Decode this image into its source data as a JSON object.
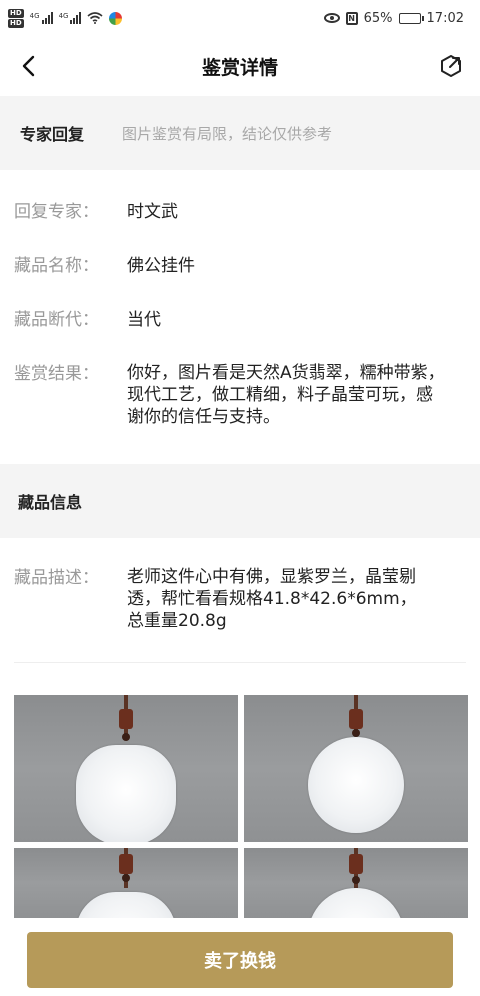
{
  "status_bar": {
    "hd_top": "HD",
    "hd_bottom": "HD",
    "signal_label_1": "4G",
    "signal_label_2": "4G",
    "battery_percent": "65%",
    "time": "17:02",
    "battery_level": 0.65,
    "icons": [
      "hd-icon",
      "signal-icon",
      "wifi-icon",
      "app-icon",
      "eye-icon",
      "nfc-icon",
      "battery-icon"
    ]
  },
  "header": {
    "title": "鉴赏详情",
    "back_icon": "chevron-left-icon",
    "share_icon": "share-icon"
  },
  "expert_section": {
    "title": "专家回复",
    "note": "图片鉴赏有局限，结论仅供参考"
  },
  "details": [
    {
      "label": "回复专家：",
      "value": "时文武"
    },
    {
      "label": "藏品名称：",
      "value": "佛公挂件"
    },
    {
      "label": "藏品断代：",
      "value": "当代"
    },
    {
      "label": "鉴赏结果：",
      "value": "你好，图片看是天然A货翡翠，糯种带紫，现代工艺，做工精细，料子晶莹可玩，感谢你的信任与支持。"
    }
  ],
  "collection_section": {
    "title": "藏品信息"
  },
  "description": {
    "label": "藏品描述：",
    "value": "老师这件心中有佛，显紫罗兰，晶莹剔透，帮忙看看规格41.8*42.6*6mm，总重量20.8g"
  },
  "photos": [
    "jade-pendant-front",
    "jade-pendant-back",
    "jade-pendant-front-2",
    "jade-pendant-back-2"
  ],
  "bottom": {
    "sell_label": "卖了换钱",
    "accent_color": "#b69a59"
  }
}
